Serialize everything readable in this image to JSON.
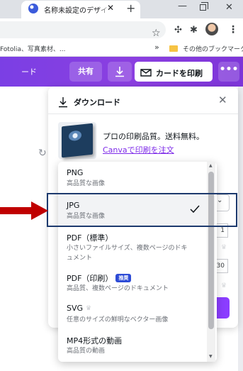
{
  "browser": {
    "tab_title": "名称未設定のデザイ",
    "tab_close": "✕",
    "new_tab": "+",
    "window_min": "—",
    "window_close": "✕",
    "menu": "⋮",
    "bookmarks_left": "Fotolia、写真素材、...",
    "bookmarks_more": "»",
    "bookmarks_other": "その他のブックマーク"
  },
  "header": {
    "card_left": "ード",
    "share_label": "共有",
    "print_label": "カードを印刷",
    "more_label": "•••",
    "accent_color": "#8b3dff"
  },
  "panel": {
    "title": "ダウンロード",
    "close": "✕",
    "promo_text": "プロの印刷品質。送料無料。",
    "promo_link": "Canvaで印刷を注文",
    "peek_num1": "1",
    "peek_num2": "30"
  },
  "dropdown": {
    "options": [
      {
        "title": "PNG",
        "desc": "高品質な画像"
      },
      {
        "title": "JPG",
        "desc": "高品質な画像",
        "selected": true
      },
      {
        "title": "PDF（標準）",
        "desc_line1": "小さいファイルサイズ、複数ページのドキ",
        "desc_line2": "ュメント"
      },
      {
        "title": "PDF（印刷）",
        "badge": "推奨",
        "desc": "高品質、複数ページのドキュメント"
      },
      {
        "title": "SVG",
        "desc": "任意のサイズの鮮明なベクター画像",
        "premium": true
      },
      {
        "title": "MP4形式の動画",
        "desc": "高品質の動画"
      }
    ]
  }
}
